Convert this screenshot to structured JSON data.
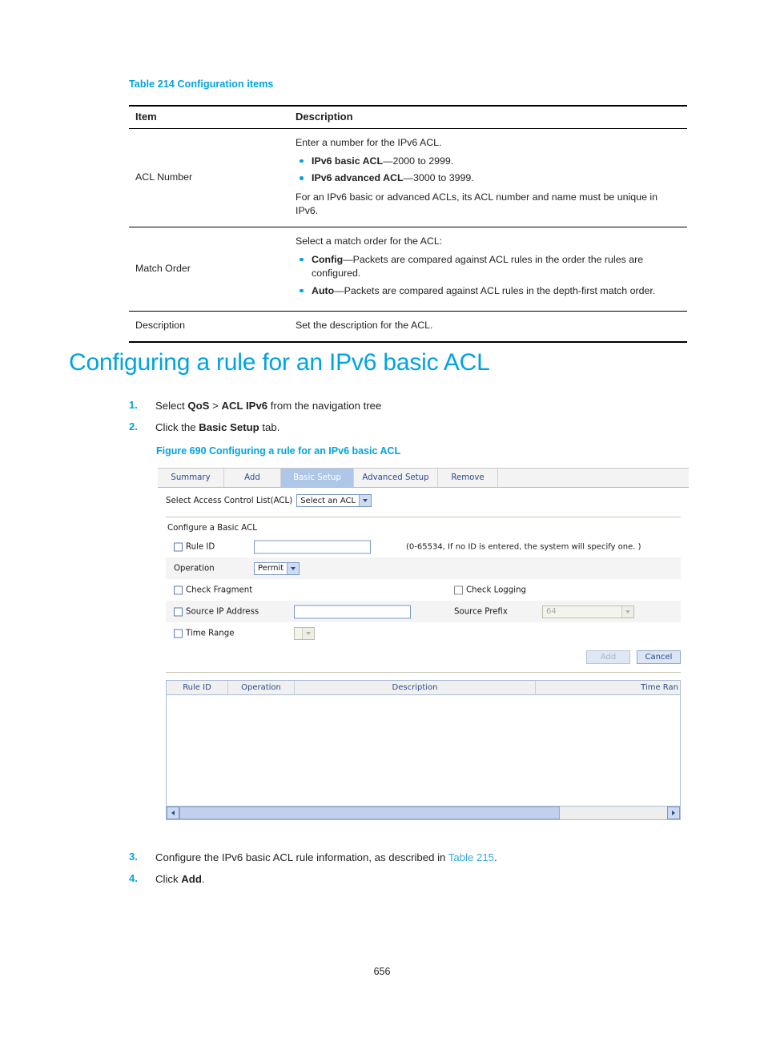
{
  "table214": {
    "caption": "Table 214 Configuration items",
    "headers": [
      "Item",
      "Description"
    ],
    "rows": [
      {
        "item": "ACL Number",
        "intro": "Enter a number for the IPv6 ACL.",
        "bullets": [
          {
            "term": "IPv6 basic ACL",
            "rest": "—2000 to 2999."
          },
          {
            "term": "IPv6 advanced ACL",
            "rest": "—3000 to 3999."
          }
        ],
        "outro": "For an IPv6 basic or advanced ACLs, its ACL number and name must be unique in IPv6."
      },
      {
        "item": "Match Order",
        "intro": "Select a match order for the ACL:",
        "bullets": [
          {
            "term": "Config",
            "rest": "—Packets are compared against ACL rules in the order the rules are configured."
          },
          {
            "term": "Auto",
            "rest": "—Packets are compared against ACL rules in the depth-first match order."
          }
        ],
        "outro": ""
      },
      {
        "item": "Description",
        "intro": "Set the description for the ACL.",
        "bullets": [],
        "outro": ""
      }
    ]
  },
  "heading": "Configuring a rule for an IPv6 basic ACL",
  "steps": {
    "one": {
      "num": "1.",
      "pre": "Select ",
      "b1": "QoS",
      "mid": " > ",
      "b2": "ACL IPv6",
      "post": " from the navigation tree"
    },
    "two": {
      "num": "2.",
      "pre": "Click the ",
      "b1": "Basic Setup",
      "post": " tab."
    },
    "three": {
      "num": "3.",
      "pre": "Configure the IPv6 basic ACL rule information, as described in ",
      "link": "Table 215",
      "post": "."
    },
    "four": {
      "num": "4.",
      "pre": "Click ",
      "b1": "Add",
      "post": "."
    }
  },
  "figure": {
    "caption": "Figure 690 Configuring a rule for an IPv6 basic ACL",
    "tabs": [
      {
        "label": "Summary",
        "active": false
      },
      {
        "label": "Add",
        "active": false
      },
      {
        "label": "Basic Setup",
        "active": true
      },
      {
        "label": "Advanced Setup",
        "active": false
      },
      {
        "label": "Remove",
        "active": false
      }
    ],
    "acl_select": {
      "label": "Select Access Control List(ACL)",
      "value": "Select an ACL"
    },
    "form": {
      "title": "Configure a Basic ACL",
      "rule_id_label": "Rule ID",
      "rule_id_value": "",
      "rule_id_hint": "(0-65534, If no ID is entered, the system will specify one. )",
      "operation_label": "Operation",
      "operation_value": "Permit",
      "check_fragment_label": "Check Fragment",
      "check_logging_label": "Check Logging",
      "source_ip_label": "Source IP Address",
      "source_ip_value": "",
      "source_prefix_label": "Source Prefix",
      "source_prefix_value": "64",
      "time_range_label": "Time Range",
      "time_range_value": "",
      "add_button": "Add",
      "cancel_button": "Cancel"
    },
    "grid": {
      "columns": [
        "Rule ID",
        "Operation",
        "Description",
        "Time Ran"
      ],
      "rows": []
    }
  },
  "page_number": "656"
}
